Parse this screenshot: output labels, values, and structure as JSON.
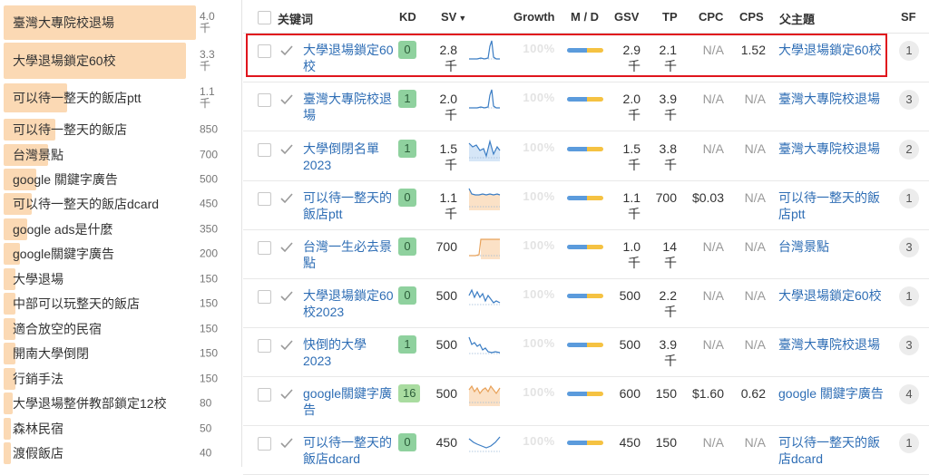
{
  "left_panel": {
    "items": [
      {
        "label": "臺灣大專院校退場",
        "value": "4.0\n千",
        "fill": 0.82
      },
      {
        "label": "大學退場鎖定60校",
        "value": "3.3\n千",
        "fill": 0.78
      },
      {
        "label": "可以待一整天的飯店ptt",
        "value": "1.1\n千",
        "fill": 0.27
      },
      {
        "label": "可以待一整天的飯店",
        "value": "850",
        "fill": 0.22
      },
      {
        "label": "台灣景點",
        "value": "700",
        "fill": 0.19
      },
      {
        "label": "google 關鍵字廣告",
        "value": "500",
        "fill": 0.14
      },
      {
        "label": "可以待一整天的飯店dcard",
        "value": "450",
        "fill": 0.12
      },
      {
        "label": "google ads是什麼",
        "value": "350",
        "fill": 0.1
      },
      {
        "label": "google關鍵字廣告",
        "value": "200",
        "fill": 0.07
      },
      {
        "label": "大學退場",
        "value": "150",
        "fill": 0.05
      },
      {
        "label": "中部可以玩整天的飯店",
        "value": "150",
        "fill": 0.05
      },
      {
        "label": "適合放空的民宿",
        "value": "150",
        "fill": 0.05
      },
      {
        "label": "開南大學倒閉",
        "value": "150",
        "fill": 0.05
      },
      {
        "label": "行銷手法",
        "value": "150",
        "fill": 0.05
      },
      {
        "label": "大學退場整併教部鎖定12校",
        "value": "80",
        "fill": 0.04
      },
      {
        "label": "森林民宿",
        "value": "50",
        "fill": 0.03
      },
      {
        "label": "渡假飯店",
        "value": "40",
        "fill": 0.03
      }
    ]
  },
  "table": {
    "headers": {
      "keyword": "关键词",
      "kd": "KD",
      "sv": "SV",
      "sv_sort": "▼",
      "growth": "Growth",
      "md": "M / D",
      "gsv": "GSV",
      "tp": "TP",
      "cpc": "CPC",
      "cps": "CPS",
      "parent": "父主題",
      "sf": "SF"
    },
    "rows": [
      {
        "keyword": "大學退場鎖定60校",
        "kd": "0",
        "kd_color": "#8fd19e",
        "sv": "2.8\n千",
        "growth": "100%",
        "md_blue": 0.55,
        "gsv": "2.9\n千",
        "tp": "2.1\n千",
        "cpc": "N/A",
        "cps": "1.52",
        "parent": "大學退場鎖定60校",
        "sf": "1",
        "spark": "spike"
      },
      {
        "keyword": "臺灣大專院校退場",
        "kd": "1",
        "kd_color": "#8fd19e",
        "sv": "2.0\n千",
        "growth": "100%",
        "md_blue": 0.55,
        "gsv": "2.0\n千",
        "tp": "3.9\n千",
        "cpc": "N/A",
        "cps": "N/A",
        "parent": "臺灣大專院校退場",
        "sf": "3",
        "spark": "spike"
      },
      {
        "keyword": "大學倒閉名單2023",
        "kd": "1",
        "kd_color": "#8fd19e",
        "sv": "1.5\n千",
        "growth": "100%",
        "md_blue": 0.55,
        "gsv": "1.5\n千",
        "tp": "3.8\n千",
        "cpc": "N/A",
        "cps": "N/A",
        "parent": "臺灣大專院校退場",
        "sf": "2",
        "spark": "wave"
      },
      {
        "keyword": "可以待一整天的飯店ptt",
        "kd": "0",
        "kd_color": "#8fd19e",
        "sv": "1.1\n千",
        "growth": "100%",
        "md_blue": 0.55,
        "gsv": "1.1\n千",
        "tp": "700",
        "cpc": "$0.03",
        "cps": "N/A",
        "parent": "可以待一整天的飯店ptt",
        "sf": "1",
        "spark": "flat-orange"
      },
      {
        "keyword": "台灣一生必去景點",
        "kd": "0",
        "kd_color": "#8fd19e",
        "sv": "700",
        "growth": "100%",
        "md_blue": 0.55,
        "gsv": "1.0\n千",
        "tp": "14\n千",
        "cpc": "N/A",
        "cps": "N/A",
        "parent": "台灣景點",
        "sf": "3",
        "spark": "step-orange"
      },
      {
        "keyword": "大學退場鎖定60校2023",
        "kd": "0",
        "kd_color": "#8fd19e",
        "sv": "500",
        "growth": "100%",
        "md_blue": 0.55,
        "gsv": "500",
        "tp": "2.2\n千",
        "cpc": "N/A",
        "cps": "N/A",
        "parent": "大學退場鎖定60校",
        "sf": "1",
        "spark": "zigzag"
      },
      {
        "keyword": "快倒的大學2023",
        "kd": "1",
        "kd_color": "#8fd19e",
        "sv": "500",
        "growth": "100%",
        "md_blue": 0.55,
        "gsv": "500",
        "tp": "3.9\n千",
        "cpc": "N/A",
        "cps": "N/A",
        "parent": "臺灣大專院校退場",
        "sf": "3",
        "spark": "decay"
      },
      {
        "keyword": "google關鍵字廣告",
        "kd": "16",
        "kd_color": "#a9dca0",
        "sv": "500",
        "growth": "100%",
        "md_blue": 0.55,
        "gsv": "600",
        "tp": "150",
        "cpc": "$1.60",
        "cps": "0.62",
        "parent": "google 關鍵字廣告",
        "sf": "4",
        "spark": "wave-orange"
      },
      {
        "keyword": "可以待一整天的飯店dcard",
        "kd": "0",
        "kd_color": "#8fd19e",
        "sv": "450",
        "growth": "100%",
        "md_blue": 0.55,
        "gsv": "450",
        "tp": "150",
        "cpc": "N/A",
        "cps": "N/A",
        "parent": "可以待一整天的飯店dcard",
        "sf": "1",
        "spark": "valley"
      }
    ]
  },
  "colors": {
    "link": "#2f6eb5",
    "highlight": "#e0151d",
    "bar": "#fbd9b4"
  }
}
